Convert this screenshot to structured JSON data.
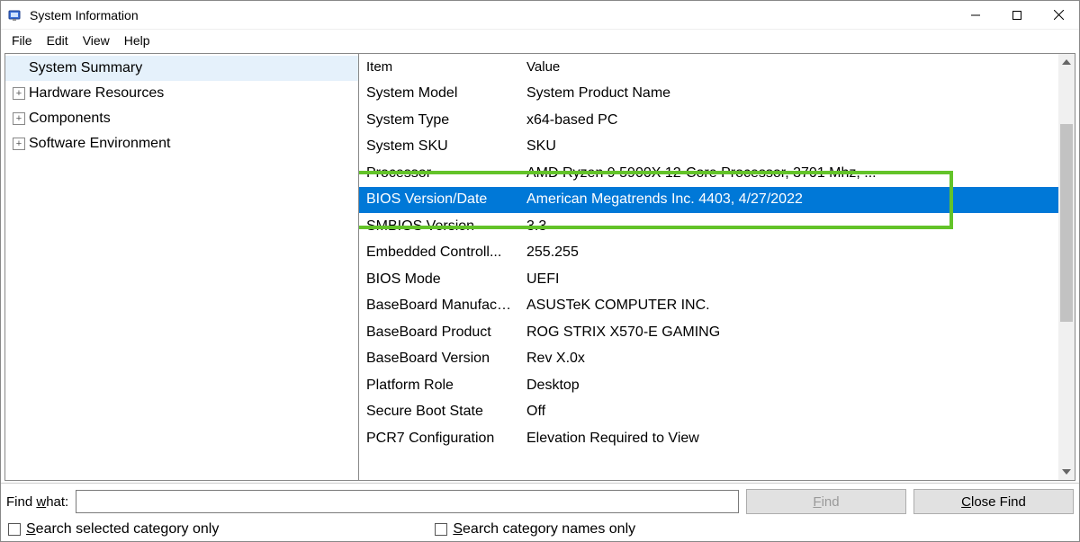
{
  "title": "System Information",
  "menus": [
    "File",
    "Edit",
    "View",
    "Help"
  ],
  "tree": [
    {
      "label": "System Summary",
      "expandable": false,
      "selected": true
    },
    {
      "label": "Hardware Resources",
      "expandable": true,
      "selected": false
    },
    {
      "label": "Components",
      "expandable": true,
      "selected": false
    },
    {
      "label": "Software Environment",
      "expandable": true,
      "selected": false
    }
  ],
  "list": {
    "headers": [
      "Item",
      "Value"
    ],
    "rows": [
      {
        "item": "System Model",
        "value": "System Product Name"
      },
      {
        "item": "System Type",
        "value": "x64-based PC"
      },
      {
        "item": "System SKU",
        "value": "SKU"
      },
      {
        "item": "Processor",
        "value": "AMD Ryzen 9 5900X 12-Core Processor, 3701 Mhz, ..."
      },
      {
        "item": "BIOS Version/Date",
        "value": "American Megatrends Inc. 4403, 4/27/2022",
        "selected": true
      },
      {
        "item": "SMBIOS Version",
        "value": "3.3"
      },
      {
        "item": "Embedded Controll...",
        "value": "255.255"
      },
      {
        "item": "BIOS Mode",
        "value": "UEFI"
      },
      {
        "item": "BaseBoard Manufact...",
        "value": "ASUSTeK COMPUTER INC."
      },
      {
        "item": "BaseBoard Product",
        "value": "ROG STRIX X570-E GAMING"
      },
      {
        "item": "BaseBoard Version",
        "value": "Rev X.0x"
      },
      {
        "item": "Platform Role",
        "value": "Desktop"
      },
      {
        "item": "Secure Boot State",
        "value": "Off"
      },
      {
        "item": "PCR7 Configuration",
        "value": "Elevation Required to View"
      }
    ],
    "highlight_row_index": 4
  },
  "findbar": {
    "label_prefix": "Find ",
    "label_ul": "w",
    "label_suffix": "hat:",
    "input_value": "",
    "find_ul": "F",
    "find_rest": "ind",
    "close_ul": "C",
    "close_rest": "lose Find",
    "chk1_ul": "S",
    "chk1_rest": "earch selected category only",
    "chk2_ul": "S",
    "chk2_rest": "earch category names only"
  },
  "colors": {
    "selection": "#0078d7",
    "highlight_border": "#63c329"
  }
}
